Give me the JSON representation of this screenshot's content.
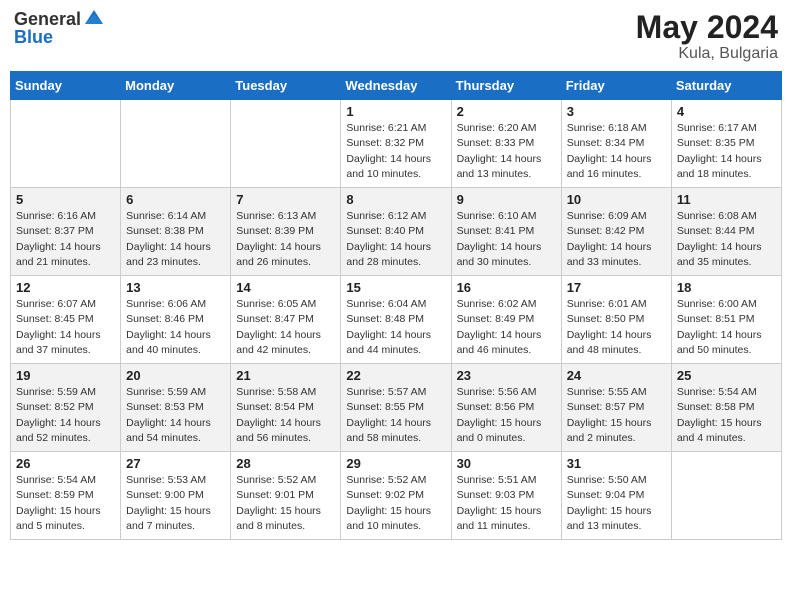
{
  "header": {
    "logo_general": "General",
    "logo_blue": "Blue",
    "month_title": "May 2024",
    "location": "Kula, Bulgaria"
  },
  "weekdays": [
    "Sunday",
    "Monday",
    "Tuesday",
    "Wednesday",
    "Thursday",
    "Friday",
    "Saturday"
  ],
  "weeks": [
    [
      {
        "day": "",
        "info": ""
      },
      {
        "day": "",
        "info": ""
      },
      {
        "day": "",
        "info": ""
      },
      {
        "day": "1",
        "info": "Sunrise: 6:21 AM\nSunset: 8:32 PM\nDaylight: 14 hours\nand 10 minutes."
      },
      {
        "day": "2",
        "info": "Sunrise: 6:20 AM\nSunset: 8:33 PM\nDaylight: 14 hours\nand 13 minutes."
      },
      {
        "day": "3",
        "info": "Sunrise: 6:18 AM\nSunset: 8:34 PM\nDaylight: 14 hours\nand 16 minutes."
      },
      {
        "day": "4",
        "info": "Sunrise: 6:17 AM\nSunset: 8:35 PM\nDaylight: 14 hours\nand 18 minutes."
      }
    ],
    [
      {
        "day": "5",
        "info": "Sunrise: 6:16 AM\nSunset: 8:37 PM\nDaylight: 14 hours\nand 21 minutes."
      },
      {
        "day": "6",
        "info": "Sunrise: 6:14 AM\nSunset: 8:38 PM\nDaylight: 14 hours\nand 23 minutes."
      },
      {
        "day": "7",
        "info": "Sunrise: 6:13 AM\nSunset: 8:39 PM\nDaylight: 14 hours\nand 26 minutes."
      },
      {
        "day": "8",
        "info": "Sunrise: 6:12 AM\nSunset: 8:40 PM\nDaylight: 14 hours\nand 28 minutes."
      },
      {
        "day": "9",
        "info": "Sunrise: 6:10 AM\nSunset: 8:41 PM\nDaylight: 14 hours\nand 30 minutes."
      },
      {
        "day": "10",
        "info": "Sunrise: 6:09 AM\nSunset: 8:42 PM\nDaylight: 14 hours\nand 33 minutes."
      },
      {
        "day": "11",
        "info": "Sunrise: 6:08 AM\nSunset: 8:44 PM\nDaylight: 14 hours\nand 35 minutes."
      }
    ],
    [
      {
        "day": "12",
        "info": "Sunrise: 6:07 AM\nSunset: 8:45 PM\nDaylight: 14 hours\nand 37 minutes."
      },
      {
        "day": "13",
        "info": "Sunrise: 6:06 AM\nSunset: 8:46 PM\nDaylight: 14 hours\nand 40 minutes."
      },
      {
        "day": "14",
        "info": "Sunrise: 6:05 AM\nSunset: 8:47 PM\nDaylight: 14 hours\nand 42 minutes."
      },
      {
        "day": "15",
        "info": "Sunrise: 6:04 AM\nSunset: 8:48 PM\nDaylight: 14 hours\nand 44 minutes."
      },
      {
        "day": "16",
        "info": "Sunrise: 6:02 AM\nSunset: 8:49 PM\nDaylight: 14 hours\nand 46 minutes."
      },
      {
        "day": "17",
        "info": "Sunrise: 6:01 AM\nSunset: 8:50 PM\nDaylight: 14 hours\nand 48 minutes."
      },
      {
        "day": "18",
        "info": "Sunrise: 6:00 AM\nSunset: 8:51 PM\nDaylight: 14 hours\nand 50 minutes."
      }
    ],
    [
      {
        "day": "19",
        "info": "Sunrise: 5:59 AM\nSunset: 8:52 PM\nDaylight: 14 hours\nand 52 minutes."
      },
      {
        "day": "20",
        "info": "Sunrise: 5:59 AM\nSunset: 8:53 PM\nDaylight: 14 hours\nand 54 minutes."
      },
      {
        "day": "21",
        "info": "Sunrise: 5:58 AM\nSunset: 8:54 PM\nDaylight: 14 hours\nand 56 minutes."
      },
      {
        "day": "22",
        "info": "Sunrise: 5:57 AM\nSunset: 8:55 PM\nDaylight: 14 hours\nand 58 minutes."
      },
      {
        "day": "23",
        "info": "Sunrise: 5:56 AM\nSunset: 8:56 PM\nDaylight: 15 hours\nand 0 minutes."
      },
      {
        "day": "24",
        "info": "Sunrise: 5:55 AM\nSunset: 8:57 PM\nDaylight: 15 hours\nand 2 minutes."
      },
      {
        "day": "25",
        "info": "Sunrise: 5:54 AM\nSunset: 8:58 PM\nDaylight: 15 hours\nand 4 minutes."
      }
    ],
    [
      {
        "day": "26",
        "info": "Sunrise: 5:54 AM\nSunset: 8:59 PM\nDaylight: 15 hours\nand 5 minutes."
      },
      {
        "day": "27",
        "info": "Sunrise: 5:53 AM\nSunset: 9:00 PM\nDaylight: 15 hours\nand 7 minutes."
      },
      {
        "day": "28",
        "info": "Sunrise: 5:52 AM\nSunset: 9:01 PM\nDaylight: 15 hours\nand 8 minutes."
      },
      {
        "day": "29",
        "info": "Sunrise: 5:52 AM\nSunset: 9:02 PM\nDaylight: 15 hours\nand 10 minutes."
      },
      {
        "day": "30",
        "info": "Sunrise: 5:51 AM\nSunset: 9:03 PM\nDaylight: 15 hours\nand 11 minutes."
      },
      {
        "day": "31",
        "info": "Sunrise: 5:50 AM\nSunset: 9:04 PM\nDaylight: 15 hours\nand 13 minutes."
      },
      {
        "day": "",
        "info": ""
      }
    ]
  ]
}
